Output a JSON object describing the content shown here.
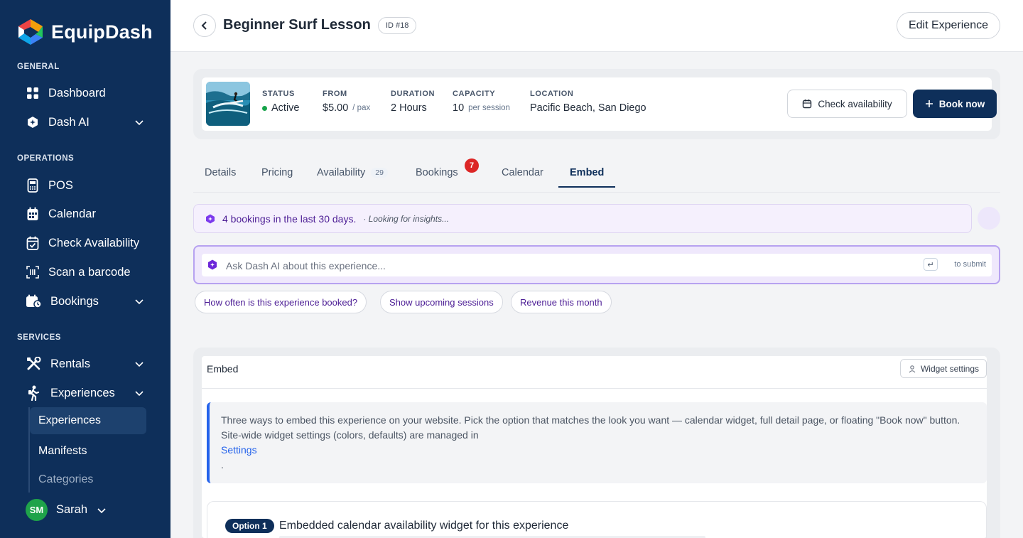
{
  "brand": {
    "name": "EquipDash"
  },
  "sidebar": {
    "sections": {
      "general": "GENERAL",
      "operations": "OPERATIONS",
      "services": "SERVICES"
    },
    "items": {
      "dashboard": "Dashboard",
      "dash_ai": "Dash AI",
      "pos": "POS",
      "calendar": "Calendar",
      "check_availability": "Check Availability",
      "scan_barcode": "Scan a barcode",
      "bookings": "Bookings",
      "rentals": "Rentals",
      "experiences": "Experiences"
    },
    "sub_items": {
      "experiences": "Experiences",
      "manifests": "Manifests",
      "categories": "Categories"
    },
    "user": {
      "initials": "SM",
      "name": "Sarah"
    },
    "colors": {
      "background": "#0e2f5a",
      "active_item": "#1d416e"
    }
  },
  "header": {
    "title": "Beginner Surf Lesson",
    "id_badge": "ID #18",
    "edit_button": "Edit Experience"
  },
  "summary": {
    "status_label": "STATUS",
    "status_value": "Active",
    "from_label": "FROM",
    "from_value": "$5.00",
    "from_unit": "/ pax",
    "duration_label": "DURATION",
    "duration_value": "2 Hours",
    "capacity_label": "CAPACITY",
    "capacity_value": "10",
    "capacity_unit": "per session",
    "location_label": "LOCATION",
    "location_value": "Pacific Beach, San Diego",
    "check_button": "Check availability",
    "book_button": "Book now"
  },
  "tabs": {
    "details": "Details",
    "pricing": "Pricing",
    "availability": "Availability",
    "availability_count": "29",
    "bookings": "Bookings",
    "bookings_badge": "7",
    "calendar": "Calendar",
    "embed": "Embed",
    "active": "Embed"
  },
  "insight": {
    "text": "4 bookings in the last 30 days.",
    "status": "· Looking for insights..."
  },
  "ask": {
    "placeholder": "Ask Dash AI about this experience...",
    "enter_key": "↵",
    "submit_hint": "to submit"
  },
  "chips": {
    "c1": "How often is this experience booked?",
    "c2": "Show upcoming sessions",
    "c3": "Revenue this month"
  },
  "embed": {
    "title": "Embed",
    "widget_settings": "Widget settings",
    "description": "Three ways to embed this experience on your website. Pick the option that matches the look you want — calendar widget, full detail page, or floating \"Book now\" button. Site-wide widget settings (colors, defaults) are managed in",
    "settings_link": "Settings",
    "period": ".",
    "option_badge": "Option 1",
    "option_title": "Embedded calendar availability widget for this experience"
  }
}
